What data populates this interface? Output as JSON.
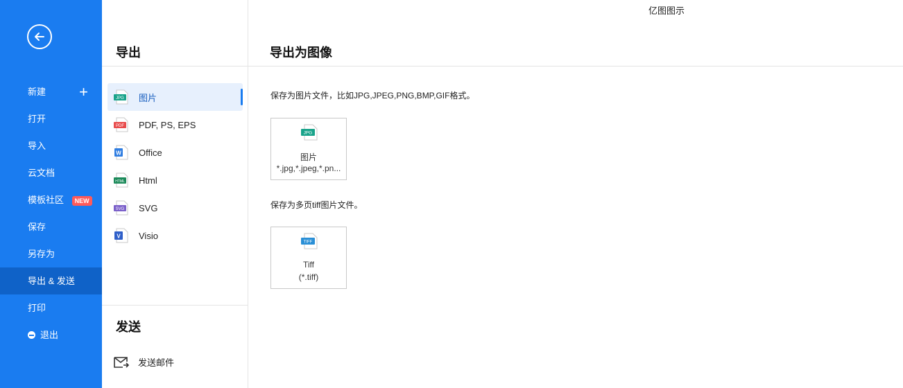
{
  "app": {
    "title": "亿图图示"
  },
  "sidebar": {
    "items": [
      {
        "label": "新建"
      },
      {
        "label": "打开"
      },
      {
        "label": "导入"
      },
      {
        "label": "云文档"
      },
      {
        "label": "模板社区",
        "badge": "NEW"
      },
      {
        "label": "保存"
      },
      {
        "label": "另存为"
      },
      {
        "label": "导出 & 发送",
        "active": true
      },
      {
        "label": "打印"
      },
      {
        "label": "退出"
      }
    ]
  },
  "export_panel": {
    "heading": "导出",
    "formats": [
      {
        "label": "图片",
        "icon": "jpg-file-icon",
        "tag": "JPG",
        "color": "#19a38a"
      },
      {
        "label": "PDF, PS, EPS",
        "icon": "pdf-file-icon",
        "tag": "PDF",
        "color": "#e84c4c"
      },
      {
        "label": "Office",
        "icon": "word-file-icon",
        "tag": "W",
        "color": "#2f7de1"
      },
      {
        "label": "Html",
        "icon": "html-file-icon",
        "tag": "HTML",
        "color": "#1c8a5a"
      },
      {
        "label": "SVG",
        "icon": "svg-file-icon",
        "tag": "SVG",
        "color": "#7a5fc9"
      },
      {
        "label": "Visio",
        "icon": "visio-file-icon",
        "tag": "V",
        "color": "#2f5fc9"
      }
    ]
  },
  "send_panel": {
    "heading": "发送",
    "item": "发送邮件"
  },
  "main": {
    "heading": "导出为图像",
    "sections": [
      {
        "description": "保存为图片文件，比如JPG,JPEG,PNG,BMP,GIF格式。",
        "card": {
          "title": "图片",
          "ext": "*.jpg,*.jpeg,*.pn...",
          "tag": "JPG",
          "color": "#19a38a"
        }
      },
      {
        "description": "保存为多页tiff图片文件。",
        "card": {
          "title": "Tiff",
          "ext": "(*.tiff)",
          "tag": "TIFF",
          "color": "#2a8fd6"
        }
      }
    ]
  }
}
